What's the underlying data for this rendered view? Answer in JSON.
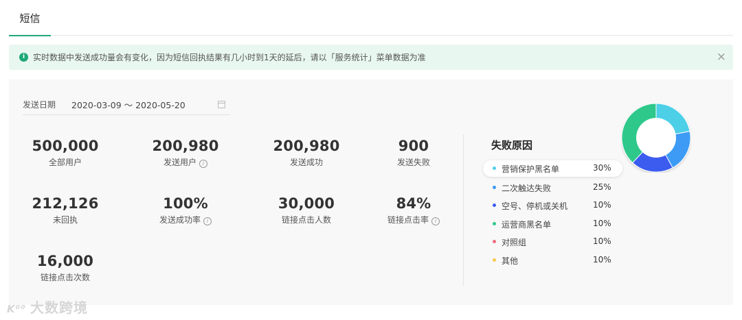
{
  "tabs": [
    {
      "label": "短信"
    }
  ],
  "notice": {
    "text": "实时数据中发送成功量会有变化，因为短信回执结果有几小时到1天的延后，请以「服务统计」菜单数据为准",
    "icon": "info-icon",
    "close_icon": "close-icon"
  },
  "filter": {
    "date_label": "发送日期",
    "date_range": "2020-03-09 ～ 2020-05-20",
    "icon": "calendar-icon"
  },
  "stats": [
    {
      "value": "500,000",
      "label": "全部用户",
      "info": false
    },
    {
      "value": "200,980",
      "label": "发送用户",
      "info": true
    },
    {
      "value": "200,980",
      "label": "发送成功",
      "info": false
    },
    {
      "value": "900",
      "label": "发送失败",
      "info": false
    },
    {
      "value": "212,126",
      "label": "未回执",
      "info": false
    },
    {
      "value": "100%",
      "label": "发送成功率",
      "info": true
    },
    {
      "value": "30,000",
      "label": "链接点击人数",
      "info": false
    },
    {
      "value": "84%",
      "label": "链接点击率",
      "info": true
    },
    {
      "value": "16,000",
      "label": "链接点击次数",
      "info": false
    }
  ],
  "failure": {
    "title": "失败原因",
    "reasons": [
      {
        "name": "营销保护黑名单",
        "pct": "30%",
        "color": "#4ecfe8"
      },
      {
        "name": "二次触达失败",
        "pct": "25%",
        "color": "#3d9bf5"
      },
      {
        "name": "空号、停机或关机",
        "pct": "10%",
        "color": "#3b5bef"
      },
      {
        "name": "运营商黑名单",
        "pct": "10%",
        "color": "#2dc88a"
      },
      {
        "name": "对照组",
        "pct": "10%",
        "color": "#ec6b7a"
      },
      {
        "name": "其他",
        "pct": "10%",
        "color": "#f7c94e"
      }
    ]
  },
  "chart_data": {
    "type": "pie",
    "categories": [
      "营销保护黑名单",
      "二次触达失败",
      "空号、停机或关机",
      "运营商黑名单"
    ],
    "values": [
      22,
      20,
      20,
      38
    ],
    "colors": [
      "#4ecfe8",
      "#3d9bf5",
      "#3b5bef",
      "#2dc88a"
    ],
    "title": "失败原因"
  },
  "watermark": {
    "logo": "K⁰⁰",
    "text": "大数跨境"
  }
}
